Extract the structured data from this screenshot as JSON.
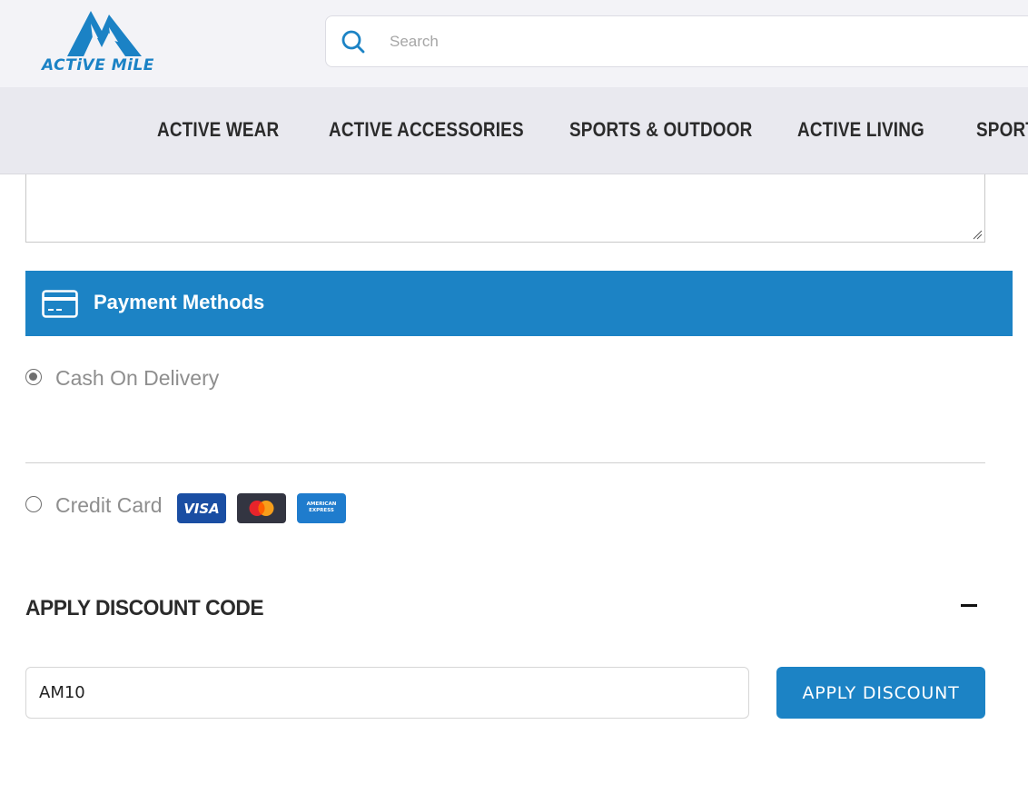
{
  "header": {
    "logo_text": "ACTiVE MiLE",
    "search": {
      "placeholder": "Search",
      "value": ""
    }
  },
  "nav": {
    "items": [
      {
        "label": "ACTIVE WEAR"
      },
      {
        "label": "ACTIVE ACCESSORIES"
      },
      {
        "label": "SPORTS & OUTDOOR"
      },
      {
        "label": "ACTIVE LIVING"
      },
      {
        "label": "SPORTS"
      }
    ]
  },
  "payment": {
    "title": "Payment Methods",
    "options": [
      {
        "label": "Cash On Delivery",
        "selected": true
      },
      {
        "label": "Credit Card",
        "selected": false
      }
    ],
    "card_brands": [
      {
        "name": "visa",
        "text": "VISA"
      },
      {
        "name": "mastercard",
        "text": ""
      },
      {
        "name": "amex",
        "text": "AMERICAN\nEXPRESS"
      }
    ]
  },
  "discount": {
    "title": "APPLY DISCOUNT CODE",
    "code_value": "AM10",
    "button_label": "APPLY DISCOUNT"
  },
  "colors": {
    "brand_blue": "#1c83c5",
    "header_bg": "#f3f3f7",
    "nav_bg": "#e9e9ef"
  },
  "icons": {
    "search": "search-icon",
    "card": "credit-card-icon",
    "collapse": "minus-icon"
  }
}
